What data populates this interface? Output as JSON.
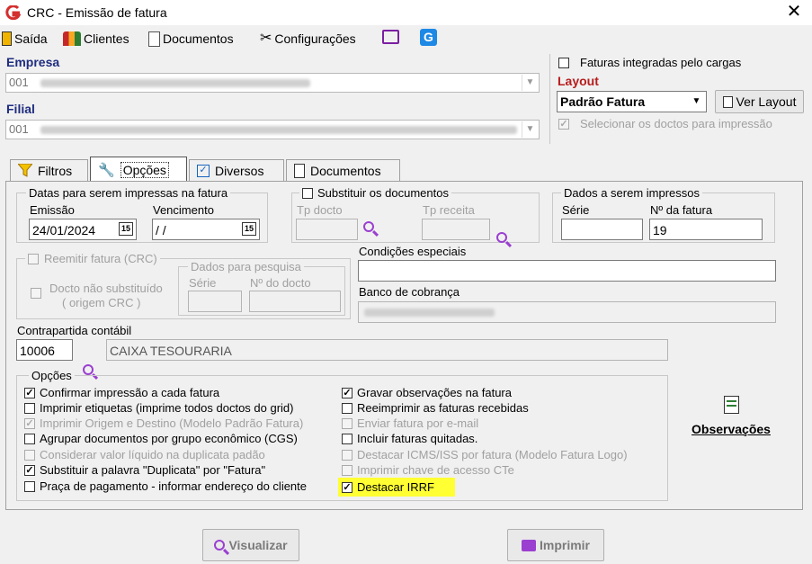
{
  "window": {
    "title": "CRC - Emissão de fatura",
    "close": "✕"
  },
  "menu": {
    "saida": "Saída",
    "clientes": "Clientes",
    "documentos": "Documentos",
    "configuracoes": "Configurações"
  },
  "empresa": {
    "label": "Empresa",
    "value": "001"
  },
  "filial": {
    "label": "Filial",
    "value": "001"
  },
  "right": {
    "faturas_integradas": "Faturas integradas pelo cargas",
    "layout_label": "Layout",
    "layout_value": "Padrão Fatura",
    "ver_layout": "Ver Layout",
    "selecionar": "Selecionar os doctos para impressão"
  },
  "tabs": {
    "filtros": "Filtros",
    "opcoes": "Opções",
    "diversos": "Diversos",
    "documentos": "Documentos"
  },
  "datas": {
    "legend": "Datas para serem impressas na fatura",
    "emissao_label": "Emissão",
    "emissao_value": "24/01/2024",
    "vencimento_label": "Vencimento",
    "vencimento_value": " / /"
  },
  "substituir": {
    "legend": "Substituir os documentos",
    "tp_docto": "Tp docto",
    "tp_receita": "Tp receita"
  },
  "dados": {
    "legend": "Dados a serem impressos",
    "serie_label": "Série",
    "nfatura_label": "Nº da fatura",
    "nfatura_value": "19"
  },
  "reemitir": {
    "label": "Reemitir fatura (CRC)",
    "docto_nao": "Docto não substituído",
    "origem": "( origem CRC )",
    "pesquisa_legend": "Dados para pesquisa",
    "serie": "Série",
    "ndocto": "Nº do docto"
  },
  "condicoes": {
    "label": "Condições especiais"
  },
  "banco": {
    "label": "Banco de cobrança"
  },
  "contrapartida": {
    "label": "Contrapartida contábil",
    "code": "10006",
    "name": "CAIXA TESOURARIA"
  },
  "opcoes": {
    "legend": "Opções",
    "left": [
      {
        "label": "Confirmar impressão a cada fatura",
        "checked": "✓"
      },
      {
        "label": "Imprimir etiquetas (imprime todos doctos do grid)",
        "checked": ""
      },
      {
        "label": "Imprimir Origem e Destino (Modelo Padrão Fatura)",
        "checked": "✓"
      },
      {
        "label": "Agrupar documentos por grupo econômico (CGS)",
        "checked": ""
      },
      {
        "label": "Considerar valor líquido na duplicata padão",
        "checked": ""
      },
      {
        "label": "Substituir a palavra \"Duplicata\" por \"Fatura\"",
        "checked": "✓"
      },
      {
        "label": "Praça de pagamento - informar endereço do cliente",
        "checked": ""
      }
    ],
    "right": [
      {
        "label": "Gravar observações na fatura",
        "checked": "✓"
      },
      {
        "label": "Reeimprimir as faturas recebidas",
        "checked": ""
      },
      {
        "label": "Enviar fatura por e-mail",
        "checked": ""
      },
      {
        "label": "Incluir faturas quitadas.",
        "checked": ""
      },
      {
        "label": "Destacar ICMS/ISS por fatura (Modelo Fatura Logo)",
        "checked": ""
      },
      {
        "label": "Imprimir chave de acesso CTe",
        "checked": ""
      },
      {
        "label": "Destacar IRRF",
        "checked": "✓"
      }
    ]
  },
  "observacoes": "Observações",
  "buttons": {
    "visualizar": "Visualizar",
    "imprimir": "Imprimir"
  },
  "colors": {
    "accent": "#9a3fd0",
    "highlight": "#ffff33",
    "label_blue": "#1f2d80"
  }
}
